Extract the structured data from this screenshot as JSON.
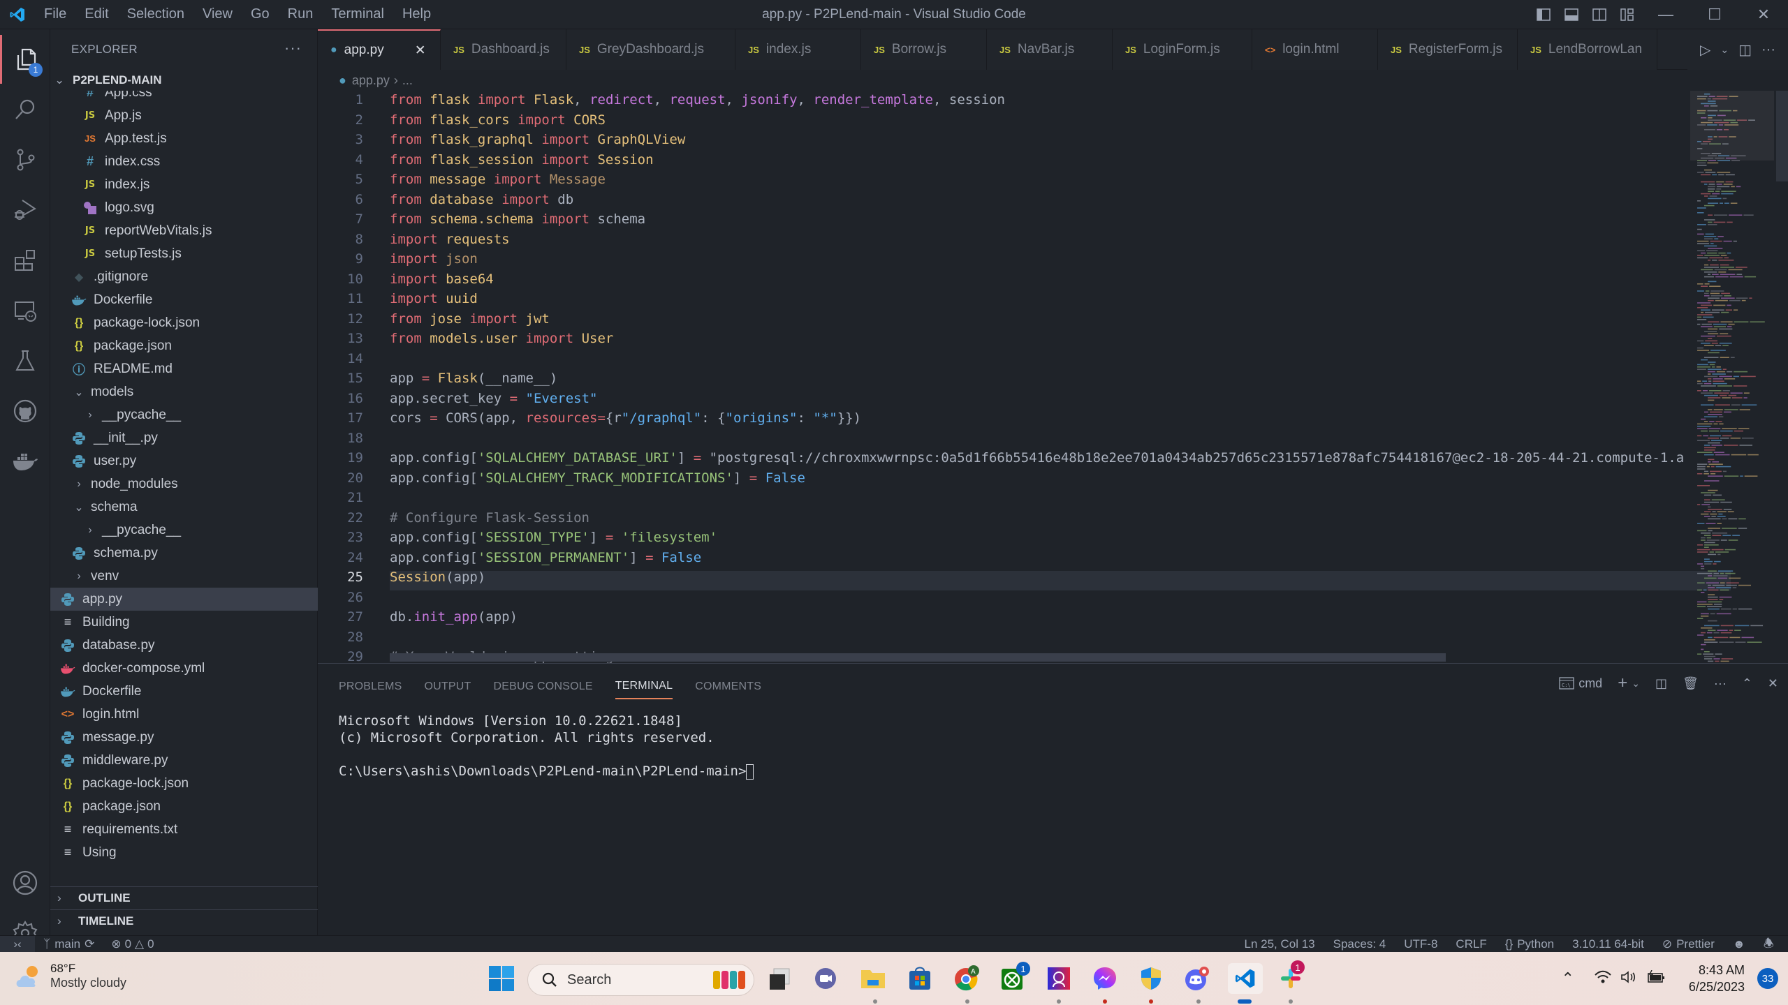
{
  "window": {
    "title": "app.py - P2PLend-main - Visual Studio Code",
    "menu": [
      "File",
      "Edit",
      "Selection",
      "View",
      "Go",
      "Run",
      "Terminal",
      "Help"
    ]
  },
  "activity_bar": {
    "items": [
      "explorer",
      "search",
      "source-control",
      "run-debug",
      "extensions",
      "remote-explorer",
      "testing",
      "github",
      "docker"
    ],
    "explorer_badge": "1",
    "bottom": [
      "accounts",
      "manage"
    ]
  },
  "sidebar": {
    "title": "EXPLORER",
    "more": "···",
    "root": "P2PLEND-MAIN",
    "items": [
      {
        "label": "App.css",
        "icon": "css",
        "depth": 3
      },
      {
        "label": "App.js",
        "icon": "js",
        "depth": 3
      },
      {
        "label": "App.test.js",
        "icon": "js-test",
        "depth": 3
      },
      {
        "label": "index.css",
        "icon": "css",
        "depth": 3
      },
      {
        "label": "index.js",
        "icon": "js",
        "depth": 3
      },
      {
        "label": "logo.svg",
        "icon": "svg",
        "depth": 3
      },
      {
        "label": "reportWebVitals.js",
        "icon": "js",
        "depth": 3
      },
      {
        "label": "setupTests.js",
        "icon": "js",
        "depth": 3
      },
      {
        "label": ".gitignore",
        "icon": "git",
        "depth": 2
      },
      {
        "label": "Dockerfile",
        "icon": "docker",
        "depth": 2
      },
      {
        "label": "package-lock.json",
        "icon": "json",
        "depth": 2
      },
      {
        "label": "package.json",
        "icon": "json",
        "depth": 2
      },
      {
        "label": "README.md",
        "icon": "info",
        "depth": 2
      },
      {
        "label": "models",
        "icon": "folder-open",
        "depth": 1
      },
      {
        "label": "__pycache__",
        "icon": "folder",
        "depth": 2
      },
      {
        "label": "__init__.py",
        "icon": "python",
        "depth": 2
      },
      {
        "label": "user.py",
        "icon": "python",
        "depth": 2
      },
      {
        "label": "node_modules",
        "icon": "folder",
        "depth": 1
      },
      {
        "label": "schema",
        "icon": "folder-open",
        "depth": 1
      },
      {
        "label": "__pycache__",
        "icon": "folder",
        "depth": 2
      },
      {
        "label": "schema.py",
        "icon": "python",
        "depth": 2
      },
      {
        "label": "venv",
        "icon": "folder",
        "depth": 1
      },
      {
        "label": "app.py",
        "icon": "python",
        "depth": 1,
        "selected": true
      },
      {
        "label": "Building",
        "icon": "text",
        "depth": 1
      },
      {
        "label": "database.py",
        "icon": "python",
        "depth": 1
      },
      {
        "label": "docker-compose.yml",
        "icon": "docker-compose",
        "depth": 1
      },
      {
        "label": "Dockerfile",
        "icon": "docker",
        "depth": 1
      },
      {
        "label": "login.html",
        "icon": "html",
        "depth": 1
      },
      {
        "label": "message.py",
        "icon": "python",
        "depth": 1
      },
      {
        "label": "middleware.py",
        "icon": "python",
        "depth": 1
      },
      {
        "label": "package-lock.json",
        "icon": "json",
        "depth": 1
      },
      {
        "label": "package.json",
        "icon": "json",
        "depth": 1
      },
      {
        "label": "requirements.txt",
        "icon": "text",
        "depth": 1
      },
      {
        "label": "Using",
        "icon": "text",
        "depth": 1
      }
    ],
    "sections": [
      "OUTLINE",
      "TIMELINE"
    ]
  },
  "tabs": [
    {
      "label": "app.py",
      "icon": "python",
      "active": true
    },
    {
      "label": "Dashboard.js",
      "icon": "js"
    },
    {
      "label": "GreyDashboard.js",
      "icon": "js"
    },
    {
      "label": "index.js",
      "icon": "js"
    },
    {
      "label": "Borrow.js",
      "icon": "js"
    },
    {
      "label": "NavBar.js",
      "icon": "js"
    },
    {
      "label": "LoginForm.js",
      "icon": "js"
    },
    {
      "label": "login.html",
      "icon": "html"
    },
    {
      "label": "RegisterForm.js",
      "icon": "js"
    },
    {
      "label": "LendBorrowLan",
      "icon": "js"
    }
  ],
  "breadcrumb": {
    "file": "app.py",
    "sep": "›",
    "rest": "..."
  },
  "editor": {
    "current_line": 25,
    "lines": [
      "from flask import Flask, redirect, request, jsonify, render_template, session",
      "from flask_cors import CORS",
      "from flask_graphql import GraphQLView",
      "from flask_session import Session",
      "from message import Message",
      "from database import db",
      "from schema.schema import schema",
      "import requests",
      "import json",
      "import base64",
      "import uuid",
      "from jose import jwt",
      "from models.user import User",
      "",
      "app = Flask(__name__)",
      "app.secret_key = \"Everest\"",
      "cors = CORS(app, resources={r\"/graphql\": {\"origins\": \"*\"}})",
      "",
      "app.config['SQLALCHEMY_DATABASE_URI'] = \"postgresql://chroxmxwwrnpsc:0a5d1f66b55416e48b18e2ee701a0434ab257d65c2315571e878afc754418167@ec2-18-205-44-21.compute-1.a",
      "app.config['SQLALCHEMY_TRACK_MODIFICATIONS'] = False",
      "",
      "# Configure Flask-Session",
      "app.config['SESSION_TYPE'] = 'filesystem'",
      "app.config['SESSION_PERMANENT'] = False",
      "Session(app)",
      "",
      "db.init_app(app)",
      "",
      "# Your Worldcoin app settings"
    ]
  },
  "panel": {
    "tabs": [
      "PROBLEMS",
      "OUTPUT",
      "DEBUG CONSOLE",
      "TERMINAL",
      "COMMENTS"
    ],
    "active_tab": "TERMINAL",
    "terminal_profile": "cmd",
    "terminal_lines": [
      "Microsoft Windows [Version 10.0.22621.1848]",
      "(c) Microsoft Corporation. All rights reserved.",
      "",
      "C:\\Users\\ashis\\Downloads\\P2PLend-main\\P2PLend-main>"
    ]
  },
  "statusbar": {
    "branch": "main",
    "errors": "0",
    "warnings": "0",
    "position": "Ln 25, Col 13",
    "indent": "Spaces: 4",
    "encoding": "UTF-8",
    "eol": "CRLF",
    "language": "Python",
    "interpreter": "3.10.11 64-bit",
    "formatter": "Prettier"
  },
  "taskbar": {
    "weather_temp": "68°F",
    "weather_desc": "Mostly cloudy",
    "search_label": "Search",
    "apps": [
      "task-view",
      "teams-meet",
      "file-explorer",
      "microsoft-store",
      "chrome",
      "xbox",
      "app-portrait",
      "messenger",
      "windows-security",
      "discord",
      "vscode",
      "slack"
    ],
    "xbox_badge": "1",
    "slack_badge": "1",
    "time": "8:43 AM",
    "date": "6/25/2023",
    "notifications": "33"
  }
}
